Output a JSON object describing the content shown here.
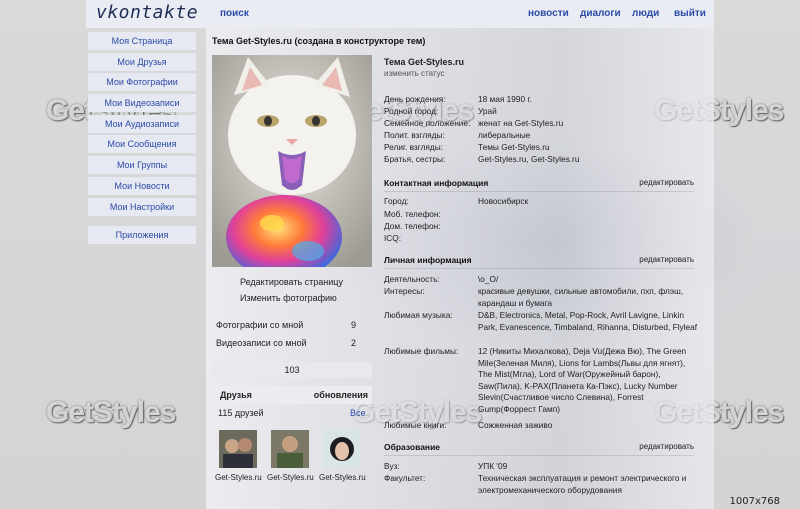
{
  "topbar": {
    "logo": "vkontakte",
    "search": "поиск",
    "nav": [
      "новости",
      "диалоги",
      "люди",
      "выйти"
    ]
  },
  "sidebar": {
    "items": [
      "Моя Страница",
      "Мои Друзья",
      "Мои Фотографии",
      "Мои Видеозаписи",
      "Мои Аудиозаписи",
      "Мои Сообщения",
      "Мои Группы",
      "Мои Новости",
      "Мои Настройки"
    ],
    "apps": "Приложения"
  },
  "page_title": "Тема Get-Styles.ru (создана в конструкторе тем)",
  "left": {
    "edit_page": "Редактировать страницу",
    "change_photo": "Изменить фотографию",
    "photos_with_me": "Фотографии со мной",
    "photos_with_me_count": "9",
    "videos_with_me": "Видеозаписи со мной",
    "videos_with_me_count": "2",
    "albums_count": "103",
    "friends_title": "Друзья",
    "friends_updates": "обновления",
    "friends_count": "115 друзей",
    "friends_all": "Все",
    "friends": [
      {
        "name": "Get-Styles.ru"
      },
      {
        "name": "Get-Styles.ru"
      },
      {
        "name": "Get-Styles.ru"
      }
    ]
  },
  "profile": {
    "name": "Тема Get-Styles.ru",
    "status_link": "изменить статус",
    "basic": [
      {
        "label": "День рождения:",
        "value": "18 мая 1990 г."
      },
      {
        "label": "Родной город:",
        "value": "Урай"
      },
      {
        "label": "Семейное положение:",
        "value": "женат на  Get-Styles.ru"
      },
      {
        "label": "Полит. взгляды:",
        "value": "либеральные"
      },
      {
        "label": "Религ. взгляды:",
        "value": "Темы Get-Styles.ru"
      },
      {
        "label": "Братья, сестры:",
        "value": "Get-Styles.ru, Get-Styles.ru"
      }
    ],
    "contacts_title": "Контактная информация",
    "contacts": [
      {
        "label": "Город:",
        "value": "Новосибирск"
      },
      {
        "label": "Моб. телефон:",
        "value": ""
      },
      {
        "label": "Дом. телефон:",
        "value": ""
      },
      {
        "label": "ICQ:",
        "value": ""
      }
    ],
    "personal_title": "Личная информация",
    "personal": [
      {
        "label": "Деятельность:",
        "value": "\\o_O/"
      },
      {
        "label": "Интересы:",
        "value": "красивые девушки, сильные автомобили, пхп, флэш, карандаш и бумага"
      },
      {
        "label": "Любимая музыка:",
        "value": "D&B, Electronics, Metal, Pop-Rock, Avril Lavigne, Linkin Park, Evanescence, Timbaland, Rihanna, Disturbed, Flyleaf"
      },
      {
        "label": "Любимые фильмы:",
        "value": "12 (Никиты Михалкова), Deja Vu(Дежа Вю), The Green Mile(Зеленая Миля), Lions for Lambs(Львы для ягнят), The Mist(Мгла), Lord of War(Оружейный барон), Saw(Пила), K-PAX(Планета Ка-Пэкс), Lucky Number Slevin(Счастливое число Слевина), Forrest Gump(Форрест Гамп)"
      },
      {
        "label": "Любимые книги:",
        "value": "Сожженная заживо"
      }
    ],
    "education_title": "Образование",
    "education": [
      {
        "label": "Вуз:",
        "value": "УПК '09"
      },
      {
        "label": "Факультет:",
        "value": "Техническая эксплуатация и ремонт электрического и электромеханического оборудования"
      }
    ],
    "edit_label": "редактировать"
  },
  "watermark": "GetStyles",
  "resolution": "1007x768"
}
